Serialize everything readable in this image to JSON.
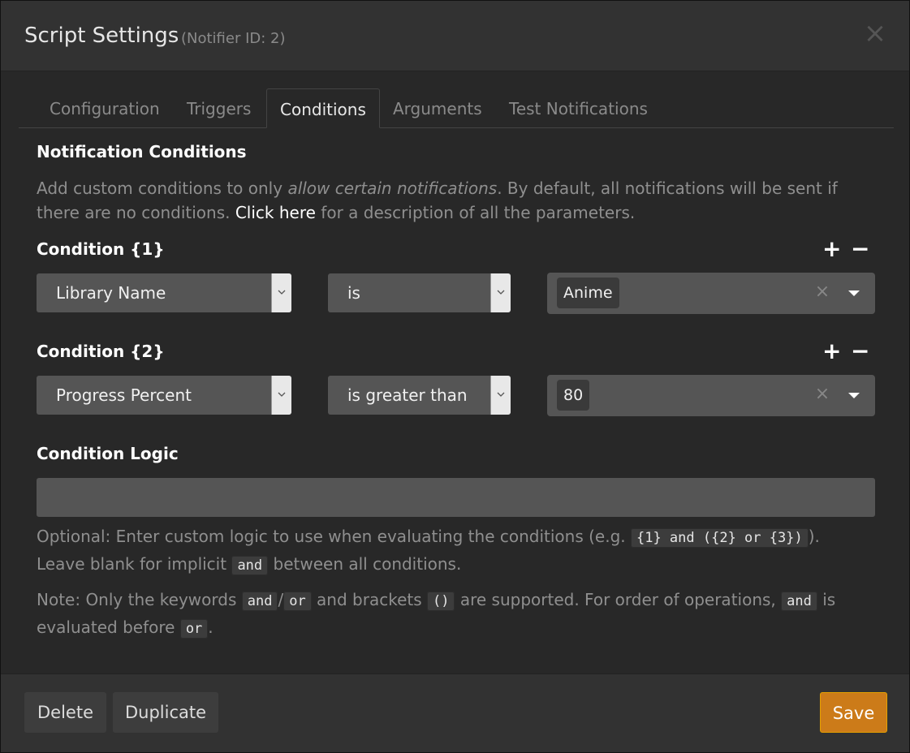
{
  "header": {
    "title": "Script Settings",
    "subtitle": "(Notifier ID: 2)",
    "close_symbol": "×"
  },
  "tabs": [
    {
      "label": "Configuration",
      "active": false
    },
    {
      "label": "Triggers",
      "active": false
    },
    {
      "label": "Conditions",
      "active": true
    },
    {
      "label": "Arguments",
      "active": false
    },
    {
      "label": "Test Notifications",
      "active": false
    }
  ],
  "notification_conditions": {
    "heading": "Notification Conditions",
    "desc_part1": "Add custom conditions to only ",
    "desc_emph": "allow certain notifications",
    "desc_part2": ". By default, all notifications will be sent if there are no conditions. ",
    "desc_link": "Click here",
    "desc_part3": " for a description of all the parameters."
  },
  "conditions": [
    {
      "label": "Condition {1}",
      "add_symbol": "+",
      "remove_symbol": "−",
      "parameter": "Library Name",
      "operator": "is",
      "value": "Anime",
      "clear_symbol": "×"
    },
    {
      "label": "Condition {2}",
      "add_symbol": "+",
      "remove_symbol": "−",
      "parameter": "Progress Percent",
      "operator": "is greater than",
      "value": "80",
      "clear_symbol": "×"
    }
  ],
  "logic": {
    "heading": "Condition Logic",
    "value": "",
    "help1_a": "Optional: Enter custom logic to use when evaluating the conditions (e.g. ",
    "help1_code": "{1} and ({2} or {3})",
    "help1_b": ").",
    "help1_c": "Leave blank for implicit ",
    "help1_code2": "and",
    "help1_d": " between all conditions.",
    "note_a": "Note: Only the keywords ",
    "note_code_and": "and",
    "note_slash": "/",
    "note_code_or": "or",
    "note_b": " and brackets ",
    "note_code_brackets": "()",
    "note_c": " are supported. For order of operations, ",
    "note_code_and2": "and",
    "note_d": " is evaluated before ",
    "note_code_or2": "or",
    "note_e": "."
  },
  "footer": {
    "delete_label": "Delete",
    "duplicate_label": "Duplicate",
    "save_label": "Save"
  },
  "colors": {
    "save_button": "#cc7b19",
    "background": "#282828",
    "input": "#555555"
  }
}
